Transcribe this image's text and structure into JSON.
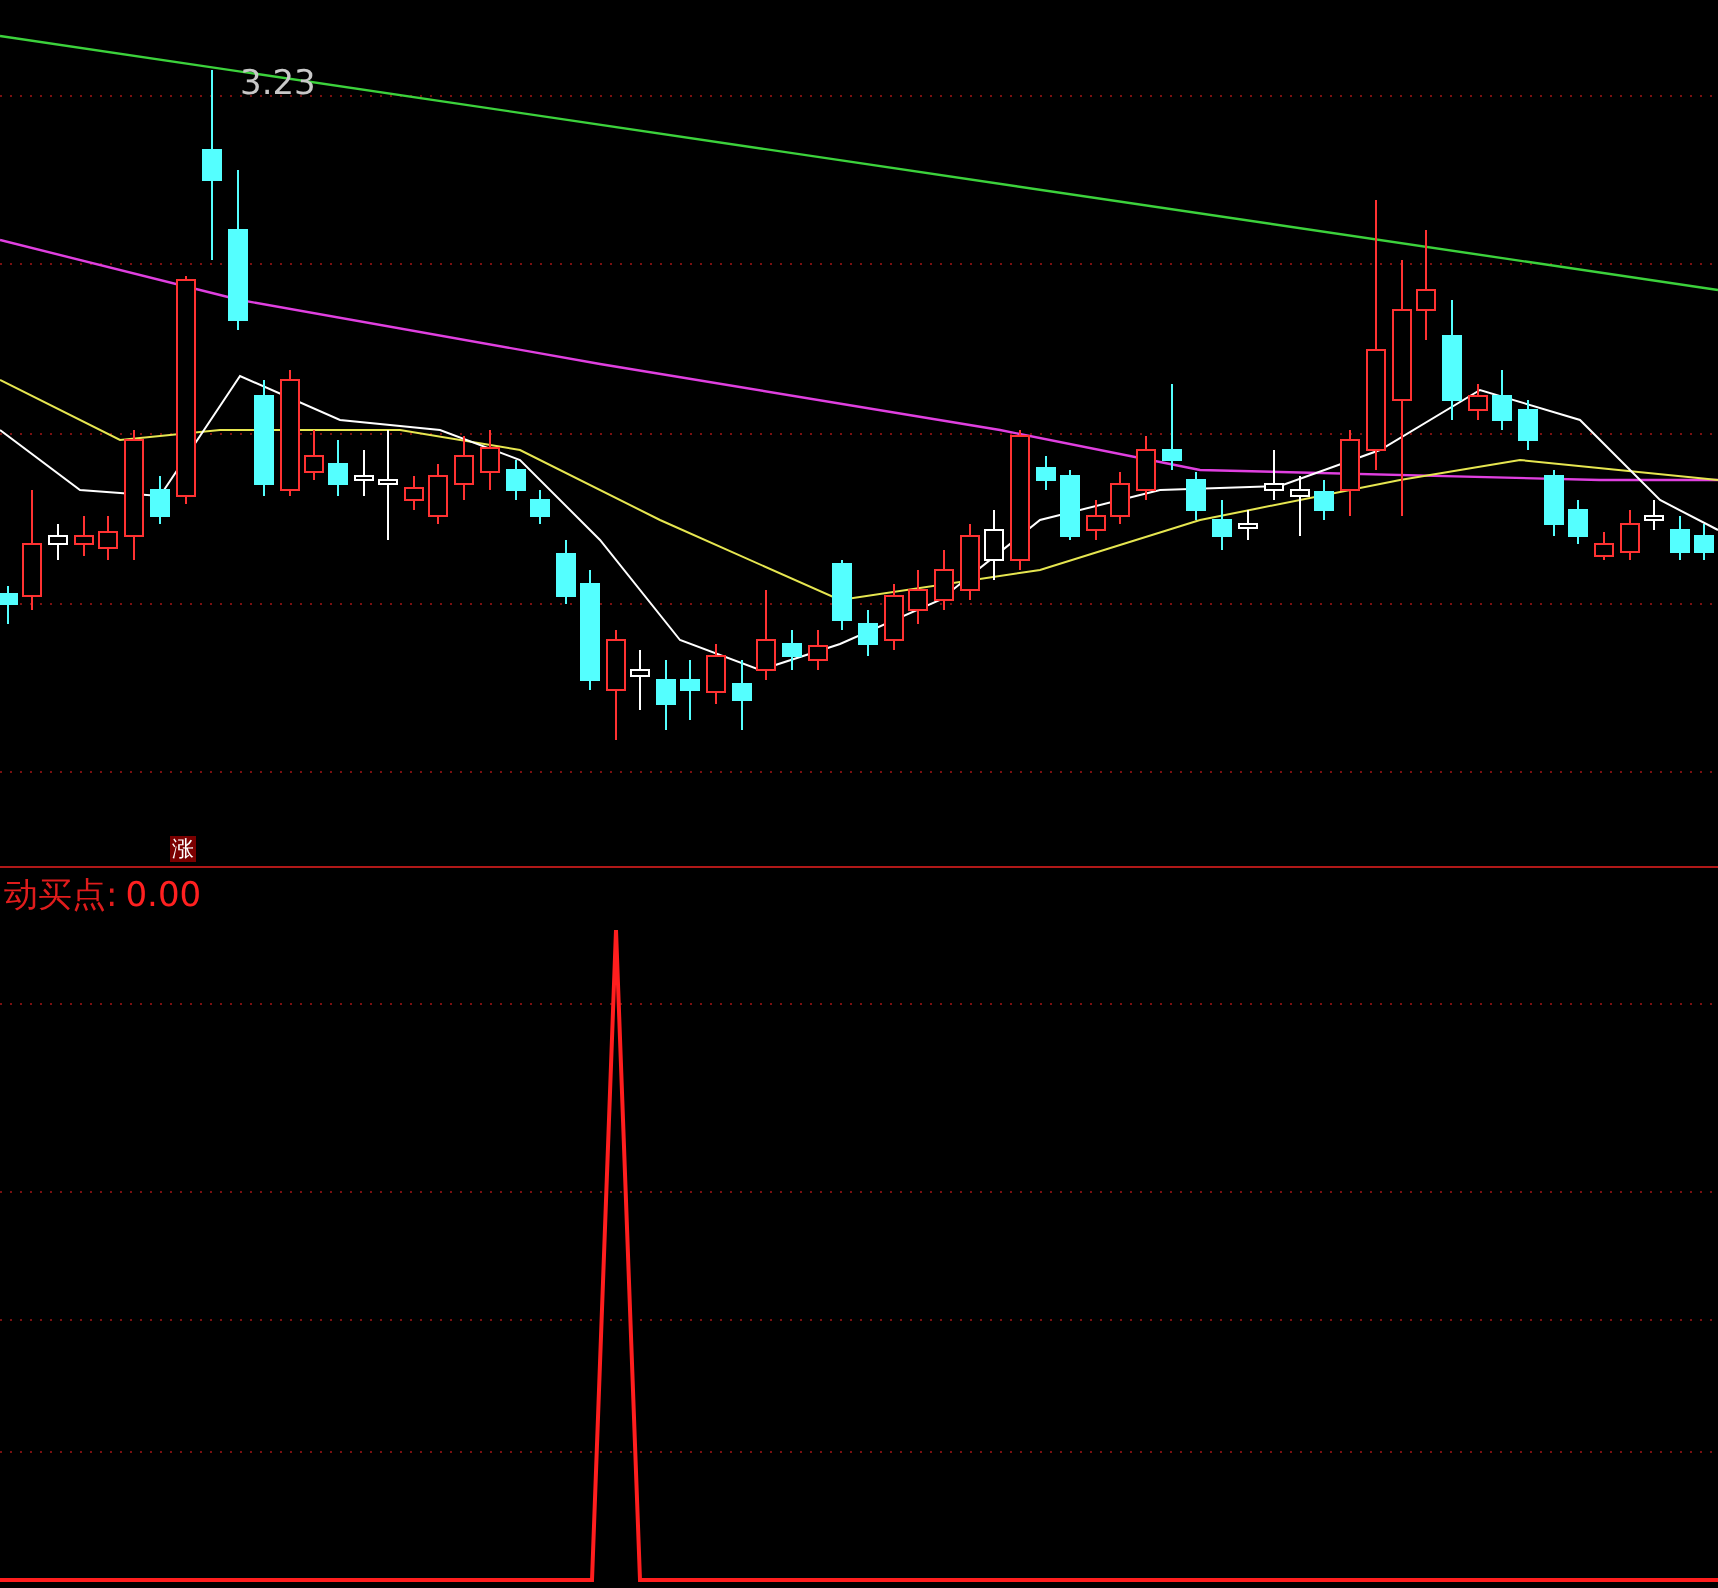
{
  "price_panel": {
    "high_label": "3.23",
    "badge": "涨"
  },
  "indicator_panel": {
    "label": "动买点:",
    "value": "0.00"
  }
}
